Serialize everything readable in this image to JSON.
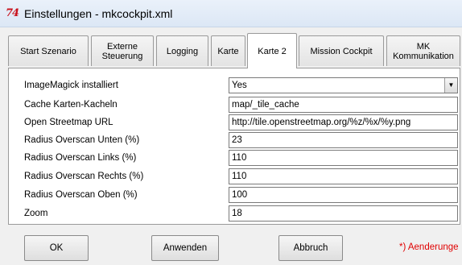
{
  "window": {
    "icon_text": "74",
    "title": "Einstellungen - mkcockpit.xml"
  },
  "tabs": [
    {
      "label": "Start Szenario"
    },
    {
      "label": "Externe\nSteuerung"
    },
    {
      "label": "Logging"
    },
    {
      "label": "Karte"
    },
    {
      "label": "Karte 2",
      "active": true
    },
    {
      "label": "Mission Cockpit"
    },
    {
      "label": "MK\nKommunikation"
    }
  ],
  "settings": [
    {
      "label": "ImageMagick installiert",
      "value": "Yes",
      "type": "select"
    },
    {
      "label": "Cache Karten-Kacheln",
      "value": "map/_tile_cache",
      "type": "text"
    },
    {
      "label": "Open Streetmap URL",
      "value": "http://tile.openstreetmap.org/%z/%x/%y.png",
      "type": "text"
    },
    {
      "label": "Radius Overscan Unten (%)",
      "value": "23",
      "type": "text"
    },
    {
      "label": "Radius Overscan Links (%)",
      "value": "110",
      "type": "text"
    },
    {
      "label": "Radius Overscan Rechts (%)",
      "value": "110",
      "type": "text"
    },
    {
      "label": "Radius Overscan Oben (%)",
      "value": "100",
      "type": "text"
    },
    {
      "label": "Zoom",
      "value": "18",
      "type": "text"
    }
  ],
  "buttons": {
    "ok": "OK",
    "apply": "Anwenden",
    "cancel": "Abbruch"
  },
  "note": "*) Aenderunge",
  "colors": {
    "icon": "#c8101a",
    "note": "#e00000",
    "titlebar": "#dce7f5"
  }
}
